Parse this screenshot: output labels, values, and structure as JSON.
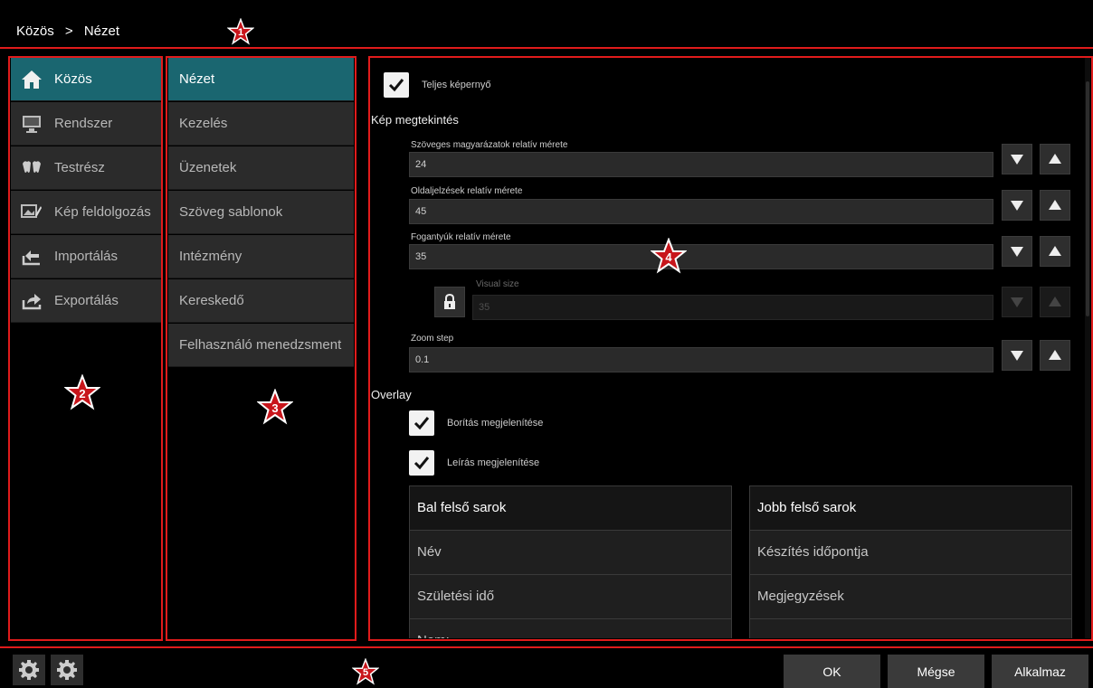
{
  "header": {
    "breadcrumb_root": "Közös",
    "breadcrumb_sep": ">",
    "breadcrumb_current": "Nézet"
  },
  "markers": [
    "1",
    "2",
    "3",
    "4",
    "5"
  ],
  "sidebar": {
    "items": [
      {
        "label": "Közös",
        "icon": "home-icon",
        "active": true
      },
      {
        "label": "Rendszer",
        "icon": "monitor-icon",
        "active": false
      },
      {
        "label": "Testrész",
        "icon": "teeth-icon",
        "active": false
      },
      {
        "label": "Kép feldolgozás",
        "icon": "image-edit-icon",
        "active": false
      },
      {
        "label": "Importálás",
        "icon": "import-icon",
        "active": false
      },
      {
        "label": "Exportálás",
        "icon": "export-icon",
        "active": false
      }
    ]
  },
  "subnav": {
    "items": [
      {
        "label": "Nézet",
        "active": true
      },
      {
        "label": "Kezelés",
        "active": false
      },
      {
        "label": "Üzenetek",
        "active": false
      },
      {
        "label": "Szöveg sablonok",
        "active": false
      },
      {
        "label": "Intézmény",
        "active": false
      },
      {
        "label": "Kereskedő",
        "active": false
      },
      {
        "label": "Felhasználó menedzsment",
        "active": false
      }
    ]
  },
  "main": {
    "fullscreen_label": "Teljes képernyő",
    "fullscreen_checked": true,
    "image_view_title": "Kép megtekintés",
    "fields": [
      {
        "label": "Szöveges magyarázatok relatív mérete",
        "value": "24",
        "enabled": true
      },
      {
        "label": "Oldaljelzések relatív mérete",
        "value": "45",
        "enabled": true
      },
      {
        "label": "Fogantyúk relatív mérete",
        "value": "35",
        "enabled": true
      },
      {
        "label": "Visual size",
        "value": "35",
        "enabled": false
      },
      {
        "label": "Zoom step",
        "value": "0.1",
        "enabled": true
      }
    ],
    "overlay_title": "Overlay",
    "show_cover_label": "Borítás megjelenítése",
    "show_cover_checked": true,
    "show_desc_label": "Leírás megjelenítése",
    "show_desc_checked": true,
    "table_left": {
      "header": "Bal felső sarok",
      "rows": [
        "Név",
        "Születési idő",
        "Nem:"
      ]
    },
    "table_right": {
      "header": "Jobb felső sarok",
      "rows": [
        "Készítés időpontja",
        "Megjegyzések",
        ""
      ]
    }
  },
  "footer": {
    "ok_label": "OK",
    "cancel_label": "Mégse",
    "apply_label": "Alkalmaz"
  },
  "colors": {
    "accent": "#1a6670",
    "frame": "#e01b1b",
    "star_fill": "#c8151b"
  }
}
